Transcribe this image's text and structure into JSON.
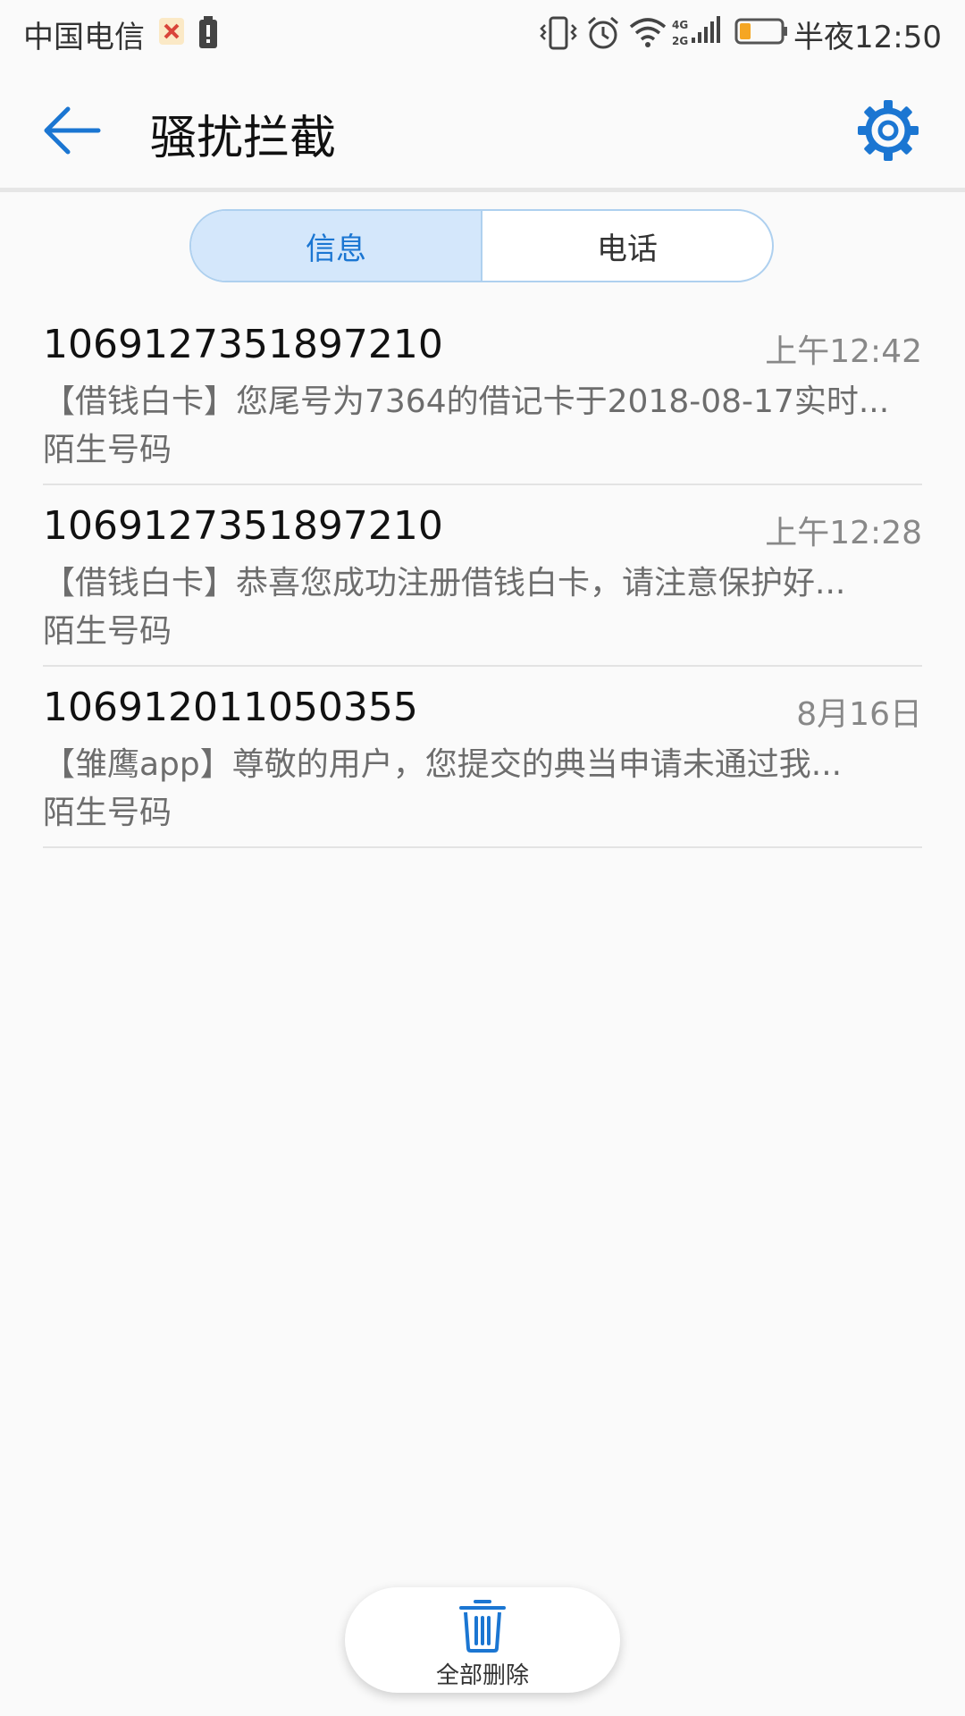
{
  "status_bar": {
    "carrier": "中国电信",
    "time": "半夜12:50",
    "icons": [
      "notification-app-icon",
      "battery-saver-icon",
      "vibrate-icon",
      "alarm-icon",
      "wifi-icon",
      "signal-4g-2g-icon",
      "battery-icon"
    ]
  },
  "header": {
    "title": "骚扰拦截",
    "back_icon": "back-arrow-icon",
    "settings_icon": "gear-icon"
  },
  "tabs": [
    {
      "label": "信息",
      "active": true
    },
    {
      "label": "电话",
      "active": false
    }
  ],
  "messages": [
    {
      "sender": "1069127351897210",
      "time": "上午12:42",
      "preview": "【借钱白卡】您尾号为7364的借记卡于2018-08-17实时...",
      "label": "陌生号码"
    },
    {
      "sender": "1069127351897210",
      "time": "上午12:28",
      "preview": "【借钱白卡】恭喜您成功注册借钱白卡，请注意保护好...",
      "label": "陌生号码"
    },
    {
      "sender": "106912011050355",
      "time": "8月16日",
      "preview": "【雏鹰app】尊敬的用户，您提交的典当申请未通过我...",
      "label": "陌生号码"
    }
  ],
  "bottom_action": {
    "label": "全部删除",
    "icon": "trash-icon"
  },
  "colors": {
    "accent": "#1b76d2",
    "tab_active_bg": "#d4e7fb",
    "background": "#fafafa"
  }
}
